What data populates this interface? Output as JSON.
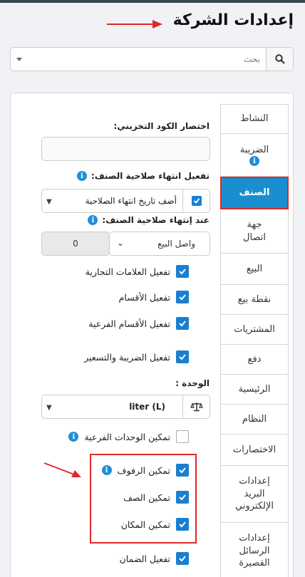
{
  "page": {
    "title": "إعدادات الشركة"
  },
  "search": {
    "placeholder": "بحث"
  },
  "tabs": [
    {
      "label": "النشاط"
    },
    {
      "label": "الضريبة",
      "info": "i"
    },
    {
      "label": "الصنف"
    },
    {
      "label": "جهة اتصال"
    },
    {
      "label": "البيع"
    },
    {
      "label": "نقطة بيع"
    },
    {
      "label": "المشتريات"
    },
    {
      "label": "دفع"
    },
    {
      "label": "الرئيسية"
    },
    {
      "label": "النظام"
    },
    {
      "label": "الاختصارات"
    },
    {
      "label": "إعدادات البريد الإلكتروني"
    },
    {
      "label": "إعدادات الرسائل القصيرة"
    }
  ],
  "form": {
    "sku_prefix_label": "اختصار الكود التخزيني:",
    "sku_prefix_value": "",
    "expiry_label": "تفعيل انتهاء صلاحية الصنف:",
    "expiry_select": "أضف تاريخ انتهاء الصلاحية",
    "on_expiry_label": "عند إنتهاء صلاحية الصنف:",
    "on_expiry_select": "واصل البيع",
    "on_expiry_days": "0",
    "brands": "تفعيل العلامات التجارية",
    "categories": "تفعيل الأقسام",
    "subcategories": "تفعيل الأقسام الفرعية",
    "tax_pricing": "تفعيل الضريبة والتسعير",
    "unit_label": "الوحدة :",
    "unit_value": "liter (L)",
    "sub_units": "تمكين الوحدات الفرعية",
    "racks": "تمكين الرفوف",
    "row": "تمكين الصف",
    "position": "تمكين المكان",
    "warranty": "تفعيل الضمان"
  },
  "colors": {
    "accent": "#1a8fd0",
    "highlight": "#e02828",
    "topbar": "#37474f"
  }
}
